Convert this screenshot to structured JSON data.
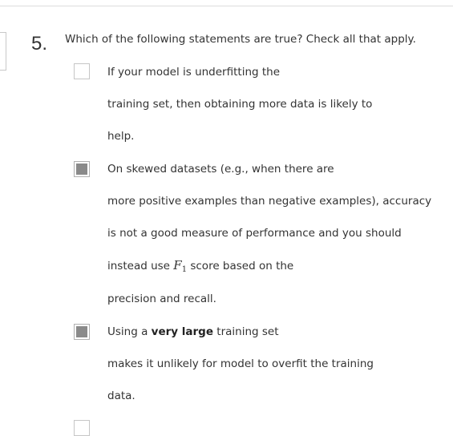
{
  "question": {
    "number": "5.",
    "prompt": "Which of the following statements are true? Check all that apply."
  },
  "options": [
    {
      "checked": false,
      "lines": [
        "If your model is underfitting the",
        "training set, then obtaining more data is likely to",
        "help."
      ]
    },
    {
      "checked": true,
      "lines": [
        "On skewed datasets (e.g., when there are",
        "more positive examples than negative examples), accuracy",
        "is not a good measure of performance and you should"
      ],
      "line4_before": "instead use ",
      "f_symbol": "F",
      "f_subscript": "1",
      "line4_after": " score based on the",
      "line5": "precision and recall."
    },
    {
      "checked": true,
      "line1_before": "Using a ",
      "line1_bold": "very large",
      "line1_after": " training set",
      "lines": [
        "makes it unlikely for model to overfit the training",
        "data."
      ]
    },
    {
      "checked": false
    }
  ]
}
